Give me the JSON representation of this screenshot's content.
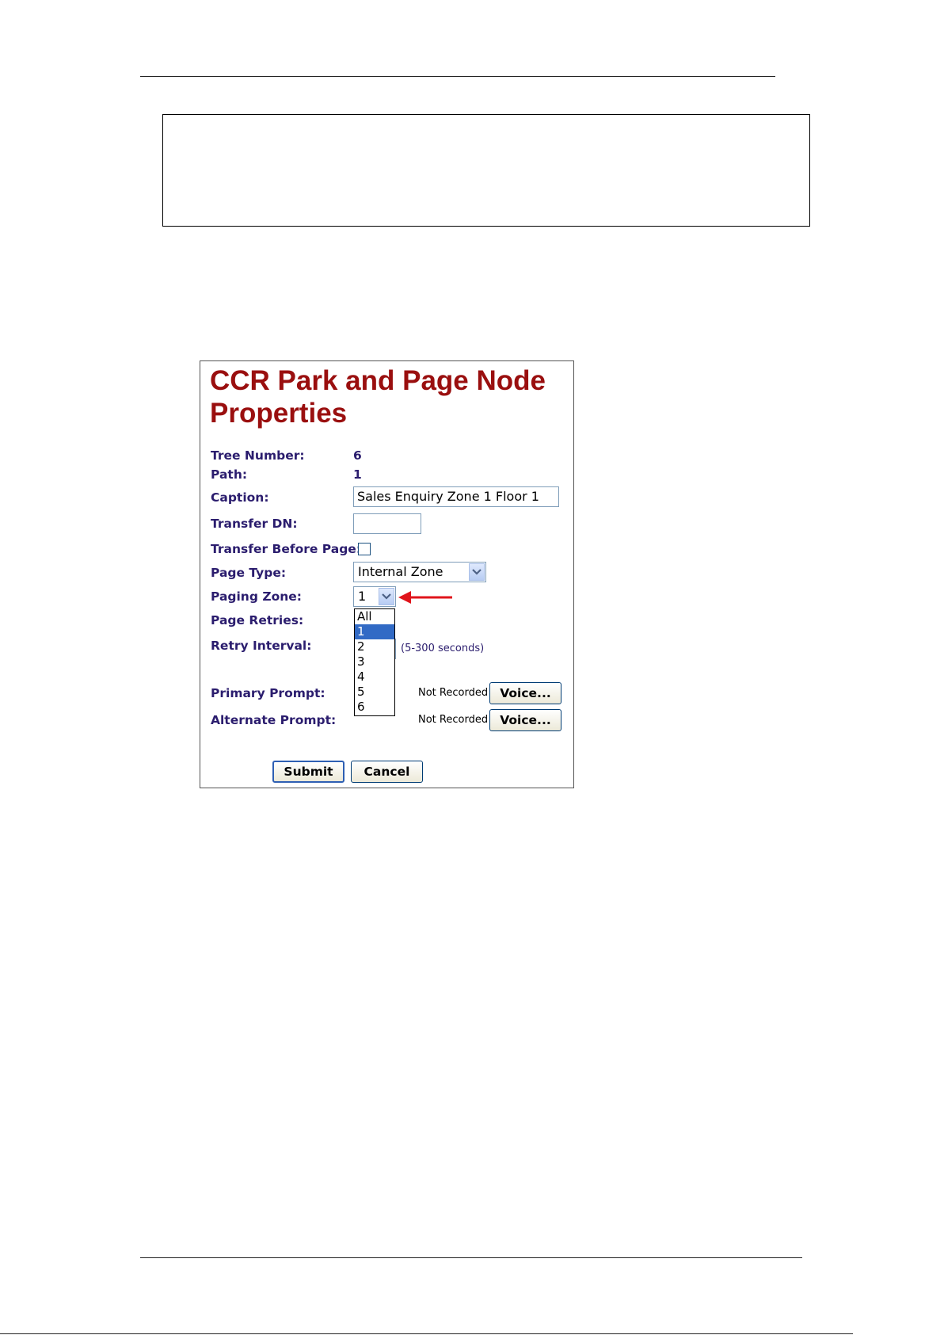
{
  "panel": {
    "title": "CCR Park and Page Node Properties",
    "fields": {
      "tree_number": {
        "label": "Tree Number:",
        "value": "6"
      },
      "path": {
        "label": "Path:",
        "value": "1"
      },
      "caption": {
        "label": "Caption:",
        "value": "Sales Enquiry Zone 1 Floor 1"
      },
      "transfer_dn": {
        "label": "Transfer DN:",
        "value": ""
      },
      "transfer_before_page": {
        "label": "Transfer Before Page:",
        "checked": false
      },
      "page_type": {
        "label": "Page Type:",
        "value": "Internal Zone"
      },
      "paging_zone": {
        "label": "Paging Zone:",
        "value": "1",
        "options": [
          "All",
          "1",
          "2",
          "3",
          "4",
          "5",
          "6"
        ],
        "selected_index": 1
      },
      "page_retries": {
        "label": "Page Retries:"
      },
      "retry_interval": {
        "label": "Retry Interval:",
        "hint": "(5-300 seconds)"
      },
      "primary_prompt": {
        "label": "Primary Prompt:",
        "status": "Not Recorded",
        "button": "Voice..."
      },
      "alternate_prompt": {
        "label": "Alternate Prompt:",
        "status": "Not Recorded",
        "button": "Voice..."
      }
    },
    "actions": {
      "submit": "Submit",
      "cancel": "Cancel"
    }
  },
  "colors": {
    "title": "#9a0f0f",
    "label": "#2b1d6e",
    "selection": "#316ac5",
    "annotation_arrow": "#e0141b"
  },
  "icons": [
    "chevron-down-icon",
    "red-arrow-annotation-icon"
  ]
}
